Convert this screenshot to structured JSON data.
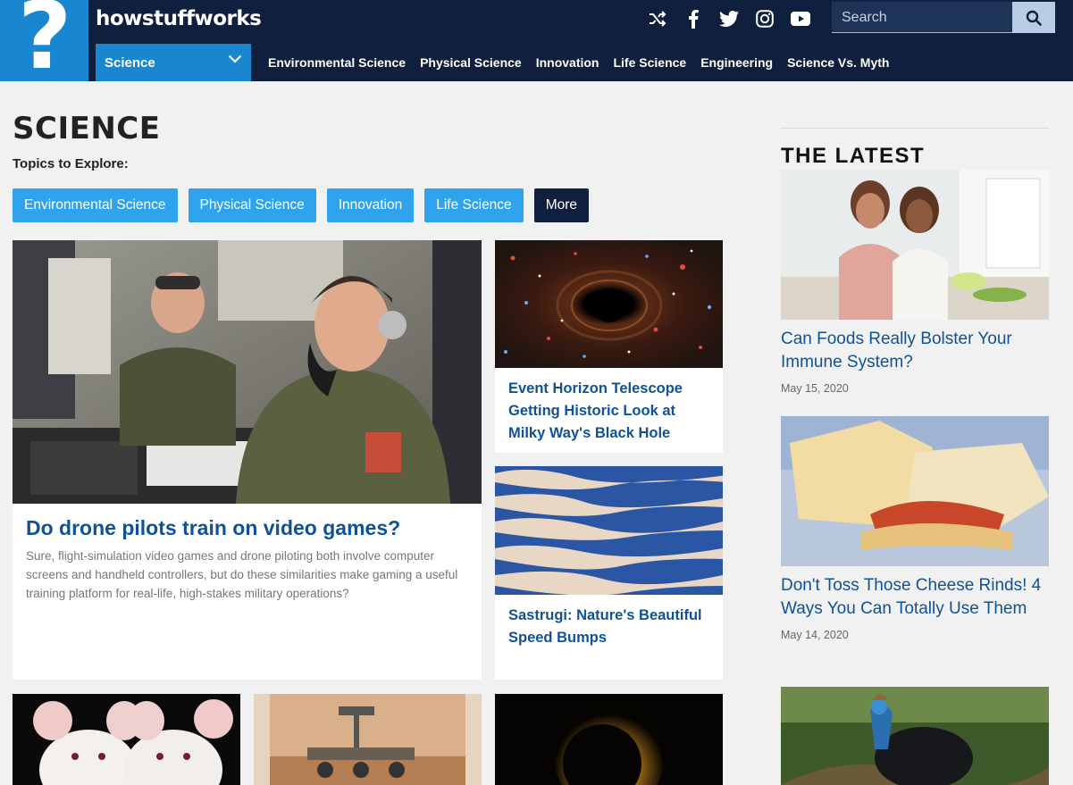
{
  "header": {
    "brand": "howstuffworks",
    "logo_mark": "?",
    "social_icons": [
      "shuffle-icon",
      "facebook-icon",
      "twitter-icon",
      "instagram-icon",
      "youtube-icon"
    ],
    "search": {
      "placeholder": "Search"
    },
    "category_select": "Science",
    "nav": [
      "Environmental Science",
      "Physical Science",
      "Innovation",
      "Life Science",
      "Engineering",
      "Science Vs. Myth"
    ]
  },
  "main": {
    "title": "SCIENCE",
    "topics_label": "Topics to Explore:",
    "topics": [
      "Environmental Science",
      "Physical Science",
      "Innovation",
      "Life Science"
    ],
    "more_label": "More",
    "featured": {
      "title": "Do drone pilots train on video games?",
      "description": "Sure, flight-simulation video games and drone piloting both involve computer screens and handheld controllers, but do these similarities make gaming a useful training platform for real-life, high-stakes military operations?"
    },
    "articles": [
      {
        "title": "Event Horizon Telescope Getting Historic Look at Milky Way's Black Hole"
      },
      {
        "title": "Sastrugi: Nature's Beautiful Speed Bumps"
      }
    ]
  },
  "latest": {
    "heading": "THE LATEST",
    "items": [
      {
        "title": "Can Foods Really Bolster Your Immune System?",
        "date": "May 15, 2020"
      },
      {
        "title": "Don't Toss Those Cheese Rinds! 4 Ways You Can Totally Use Them",
        "date": "May 14, 2020"
      }
    ]
  },
  "colors": {
    "header_bg": "#0f1f3d",
    "brand_blue": "#1a86d0",
    "pill_blue": "#2fa3ec",
    "link_blue": "#0f5297"
  }
}
